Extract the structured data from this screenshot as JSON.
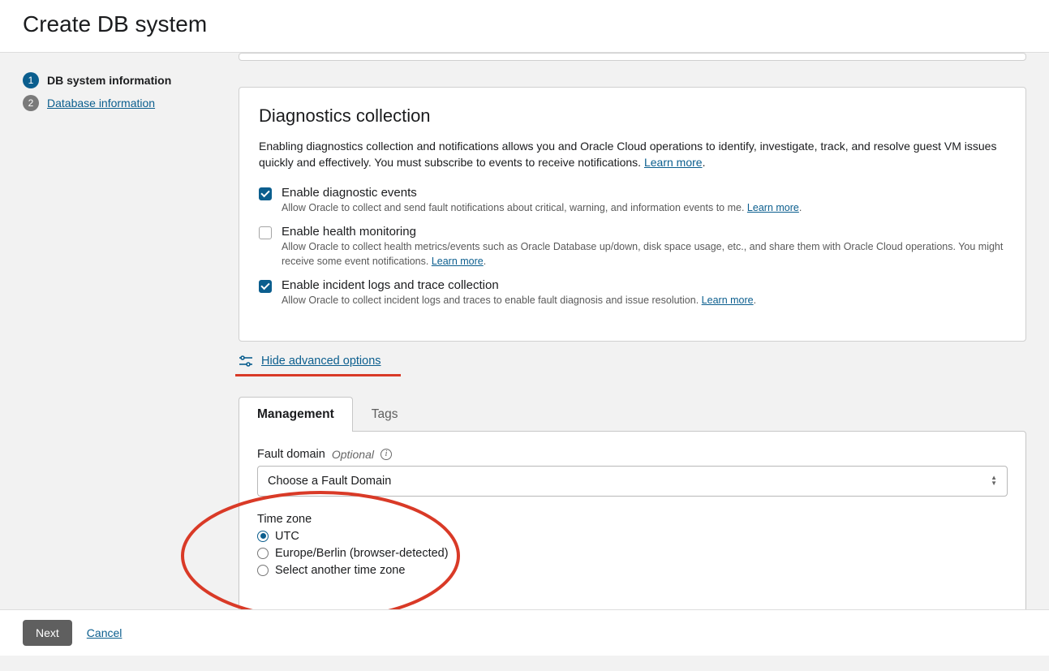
{
  "header": {
    "title": "Create DB system"
  },
  "steps": [
    {
      "num": "1",
      "label": "DB system information",
      "active": true
    },
    {
      "num": "2",
      "label": "Database information",
      "active": false
    }
  ],
  "diagnostics": {
    "title": "Diagnostics collection",
    "desc_a": "Enabling diagnostics collection and notifications allows you and Oracle Cloud operations to identify, investigate, track, and resolve guest VM issues quickly and effectively. You must subscribe to events to receive notifications. ",
    "learn_more": "Learn more",
    "items": [
      {
        "title": "Enable diagnostic events",
        "sub": "Allow Oracle to collect and send fault notifications about critical, warning, and information events to me. ",
        "learn": "Learn more",
        "checked": true
      },
      {
        "title": "Enable health monitoring",
        "sub": "Allow Oracle to collect health metrics/events such as Oracle Database up/down, disk space usage, etc., and share them with Oracle Cloud operations. You might receive some event notifications. ",
        "learn": "Learn more",
        "checked": false
      },
      {
        "title": "Enable incident logs and trace collection",
        "sub": "Allow Oracle to collect incident logs and traces to enable fault diagnosis and issue resolution. ",
        "learn": "Learn more",
        "checked": true
      }
    ]
  },
  "advanced_toggle": "Hide advanced options",
  "tabs": {
    "management": "Management",
    "tags": "Tags"
  },
  "fault_domain": {
    "label": "Fault domain",
    "optional": "Optional",
    "placeholder": "Choose a Fault Domain"
  },
  "timezone": {
    "label": "Time zone",
    "options": [
      {
        "label": "UTC",
        "checked": true
      },
      {
        "label": "Europe/Berlin (browser-detected)",
        "checked": false
      },
      {
        "label": "Select another time zone",
        "checked": false
      }
    ]
  },
  "footer": {
    "next": "Next",
    "cancel": "Cancel"
  }
}
